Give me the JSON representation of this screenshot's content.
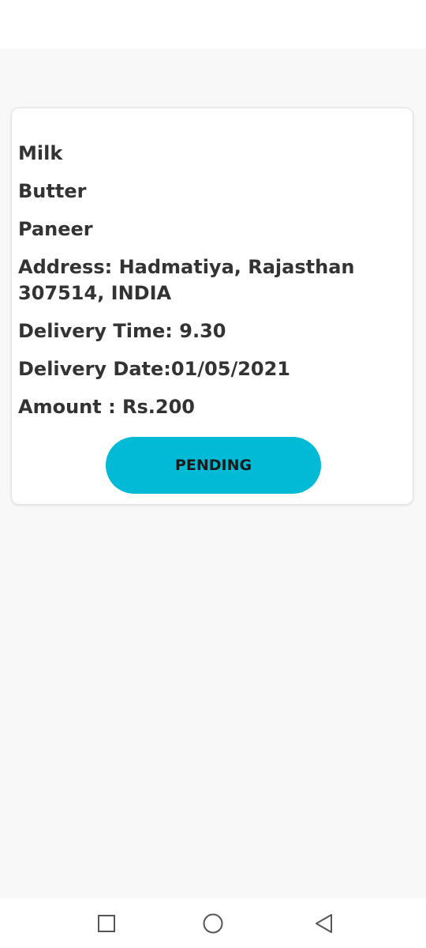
{
  "order": {
    "items": [
      "Milk",
      "Butter",
      "Paneer"
    ],
    "address": "Address: Hadmatiya, Rajasthan 307514, INDIA",
    "delivery_time": "Delivery Time: 9.30",
    "delivery_date": "Delivery Date:01/05/2021",
    "amount": "Amount : Rs.200",
    "status_label": "PENDING"
  },
  "colors": {
    "accent": "#00bad6",
    "text": "#333333",
    "background": "#f8f8f8",
    "card": "#ffffff"
  },
  "nav": {
    "icons": [
      "recent-apps-icon",
      "home-icon",
      "back-icon"
    ]
  }
}
